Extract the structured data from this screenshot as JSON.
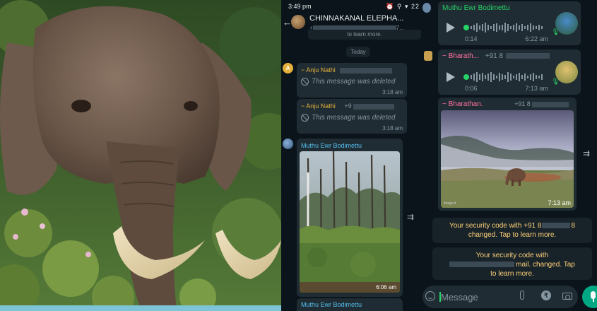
{
  "middle_chat": {
    "status_time": "3:49 pm",
    "status_icons": "⏰ ⚲ ▾ 22",
    "group_name": "CHINNAKANAL ELEPHA...",
    "group_sub_prefix": "+",
    "group_sub_suffix": "7...",
    "top_system_text": "to learn more.",
    "today_label": "Today",
    "avatar_letter": "A",
    "deleted_1": {
      "sender": "~ Anju Nathi",
      "text": "This message was deleted",
      "time": "3:18 am"
    },
    "deleted_2": {
      "sender": "~ Anju Nathi",
      "sender_phone": "+9",
      "text": "This message was deleted",
      "time": "3:18 am"
    },
    "image_message": {
      "sender": "Muthu Ewr Bodimettu",
      "time": "6:06 am"
    },
    "last_message": {
      "sender": "Muthu Ewr Bodimettu"
    }
  },
  "right_chat": {
    "voice_1": {
      "sender": "Muthu Ewr Bodimettu",
      "duration": "0:14",
      "time": "6:22 am"
    },
    "voice_2": {
      "sender": "~ Bharath...",
      "phone": "+91 8",
      "duration": "0:06",
      "time": "7:13 am"
    },
    "image_message": {
      "sender": "~ Bharathan.",
      "phone": "+91 8",
      "time": "7:13 am",
      "watermark": "image.it"
    },
    "system_1": {
      "line1_prefix": "Your security code with +91 8",
      "line1_suffix": "8",
      "line2": "changed. Tap to learn more."
    },
    "system_2": {
      "line1": "Your security code with",
      "line2_suffix": "mail. changed. Tap",
      "line3": "to learn more."
    },
    "input_placeholder": "Message",
    "rupee_symbol": "₹"
  },
  "colors": {
    "background": "#0b141a",
    "bubble": "#202c33",
    "system_text": "#ffd279",
    "accent_green": "#25d366",
    "sender_blue": "#53bdeb",
    "sender_pink": "#ff72a1"
  },
  "icons": {
    "back": "arrow-left-icon",
    "deleted": "ban-icon",
    "forward": "forward-arrow-icon",
    "play": "play-icon",
    "mic": "mic-icon",
    "emoji": "emoji-icon",
    "attach": "paperclip-icon",
    "payment": "rupee-icon",
    "camera": "camera-icon"
  }
}
